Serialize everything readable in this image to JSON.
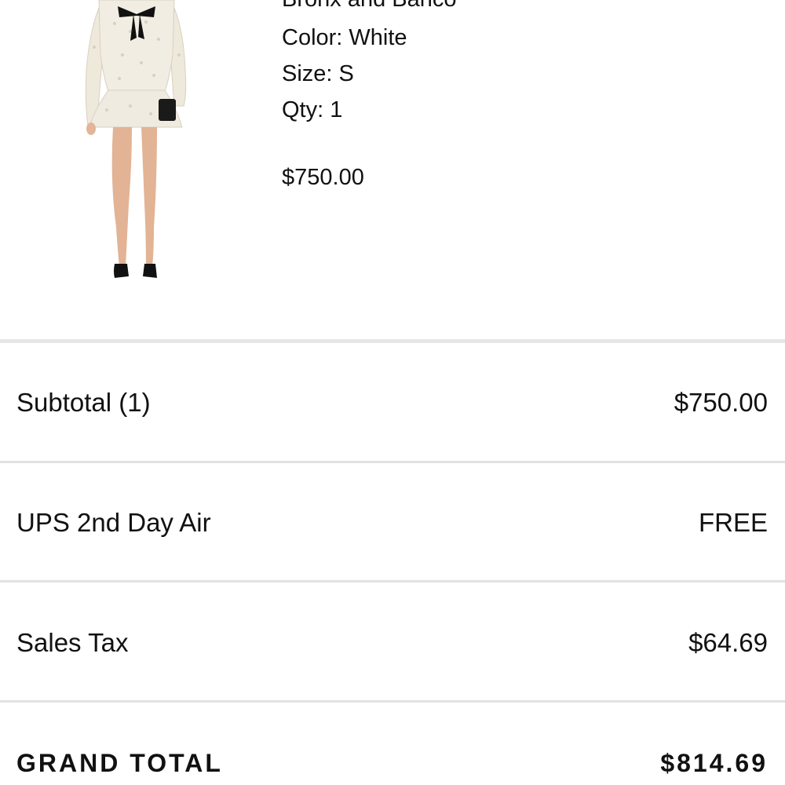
{
  "product": {
    "brand": "Bronx and Banco",
    "color": "Color: White",
    "size": "Size: S",
    "qty": "Qty: 1",
    "price": "$750.00",
    "image_icon": "product-photo-white-dress"
  },
  "summary": {
    "subtotal_label": "Subtotal (1)",
    "subtotal_value": "$750.00",
    "shipping_label": "UPS 2nd Day Air",
    "shipping_value": "FREE",
    "tax_label": "Sales Tax",
    "tax_value": "$64.69",
    "total_label": "GRAND TOTAL",
    "total_value": "$814.69"
  },
  "colors": {
    "text": "#111111",
    "divider": "#e2e2e2",
    "background": "#ffffff"
  }
}
